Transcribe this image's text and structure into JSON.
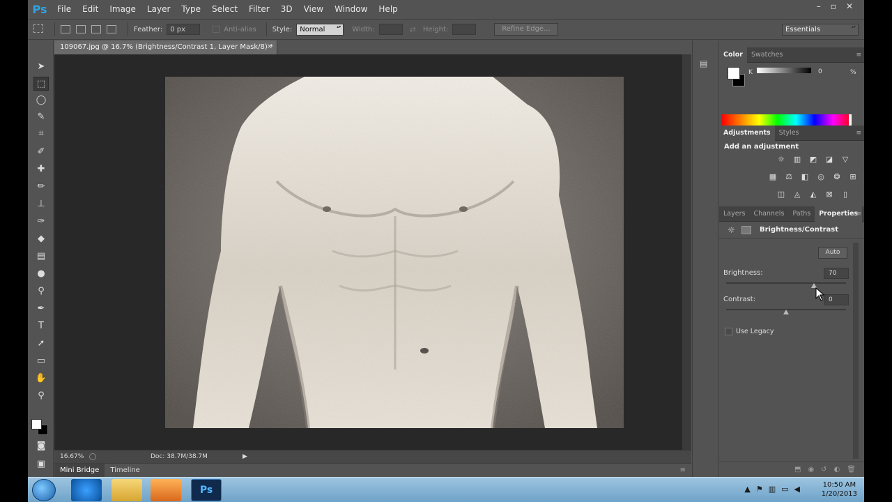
{
  "app": {
    "logo": "Ps"
  },
  "menu": [
    "File",
    "Edit",
    "Image",
    "Layer",
    "Type",
    "Select",
    "Filter",
    "3D",
    "View",
    "Window",
    "Help"
  ],
  "window_controls": [
    "–",
    "▫",
    "✕"
  ],
  "options": {
    "feather_label": "Feather:",
    "feather_value": "0 px",
    "antialias_label": "Anti-alias",
    "style_label": "Style:",
    "style_value": "Normal",
    "width_label": "Width:",
    "height_label": "Height:",
    "refine_label": "Refine Edge...",
    "workspace_value": "Essentials"
  },
  "document": {
    "tab_title": "109067.jpg @ 16.7% (Brightness/Contrast 1, Layer Mask/8) *",
    "close": "✕",
    "zoom": "16.67%",
    "doc_size": "Doc: 38.7M/38.7M",
    "arrow": "▶"
  },
  "bottom_tabs": [
    "Mini Bridge",
    "Timeline"
  ],
  "panels": {
    "color_tabs": [
      "Color",
      "Swatches"
    ],
    "k_label": "K",
    "k_value": "0",
    "k_unit": "%",
    "adjust_tabs": [
      "Adjustments",
      "Styles"
    ],
    "add_adjustment": "Add an adjustment",
    "props_tabs": [
      "Layers",
      "Channels",
      "Paths",
      "Properties"
    ],
    "props_title": "Brightness/Contrast",
    "auto_label": "Auto",
    "brightness_label": "Brightness:",
    "brightness_value": "70",
    "brightness_level": 70,
    "contrast_label": "Contrast:",
    "contrast_value": "0",
    "contrast_level": 0,
    "legacy_label": "Use Legacy",
    "menu_icon": "≡"
  },
  "taskbar": {
    "ps_label": "Ps",
    "time": "10:50 AM",
    "date": "1/20/2013"
  },
  "colors": {
    "ui_bg": "#535353",
    "canvas_bg": "#282828",
    "ps_blue": "#2fa3e6"
  }
}
